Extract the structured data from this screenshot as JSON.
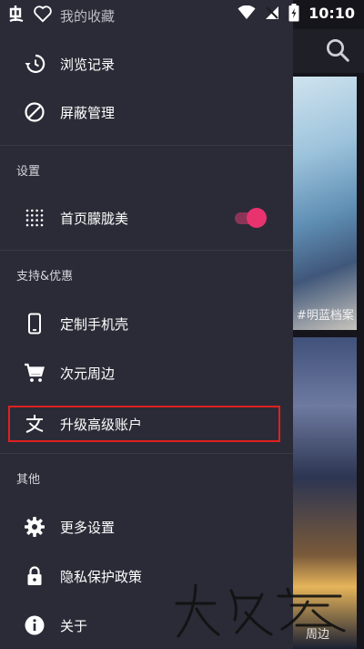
{
  "status_bar": {
    "time": "10:10",
    "app_logo_icon": "bug-logo",
    "heart_icon": "heart-outline-icon"
  },
  "header": {
    "title": "我的收藏"
  },
  "drawer": {
    "items_top": [
      {
        "label": "浏览记录",
        "icon": "history-icon"
      },
      {
        "label": "屏蔽管理",
        "icon": "block-icon"
      }
    ],
    "section_settings": {
      "header": "设置",
      "items": [
        {
          "label": "首页朦胧美",
          "icon": "dots-grid-icon",
          "toggle_on": true
        }
      ]
    },
    "section_support": {
      "header": "支持&优惠",
      "items": [
        {
          "label": "定制手机壳",
          "icon": "phone-icon"
        },
        {
          "label": "次元周边",
          "icon": "cart-icon"
        },
        {
          "label": "升级高级账户",
          "icon": "alipay-icon",
          "highlighted": true
        }
      ]
    },
    "section_other": {
      "header": "其他",
      "items": [
        {
          "label": "更多设置",
          "icon": "gear-icon"
        },
        {
          "label": "隐私保护政策",
          "icon": "lock-icon"
        },
        {
          "label": "关于",
          "icon": "info-icon"
        }
      ]
    }
  },
  "background": {
    "card1_tag": "#明蓝档案",
    "card2_tag": "周边"
  },
  "colors": {
    "drawer_bg": "#2b2b37",
    "accent_pink": "#e8336f",
    "highlight_red": "#e02020"
  }
}
